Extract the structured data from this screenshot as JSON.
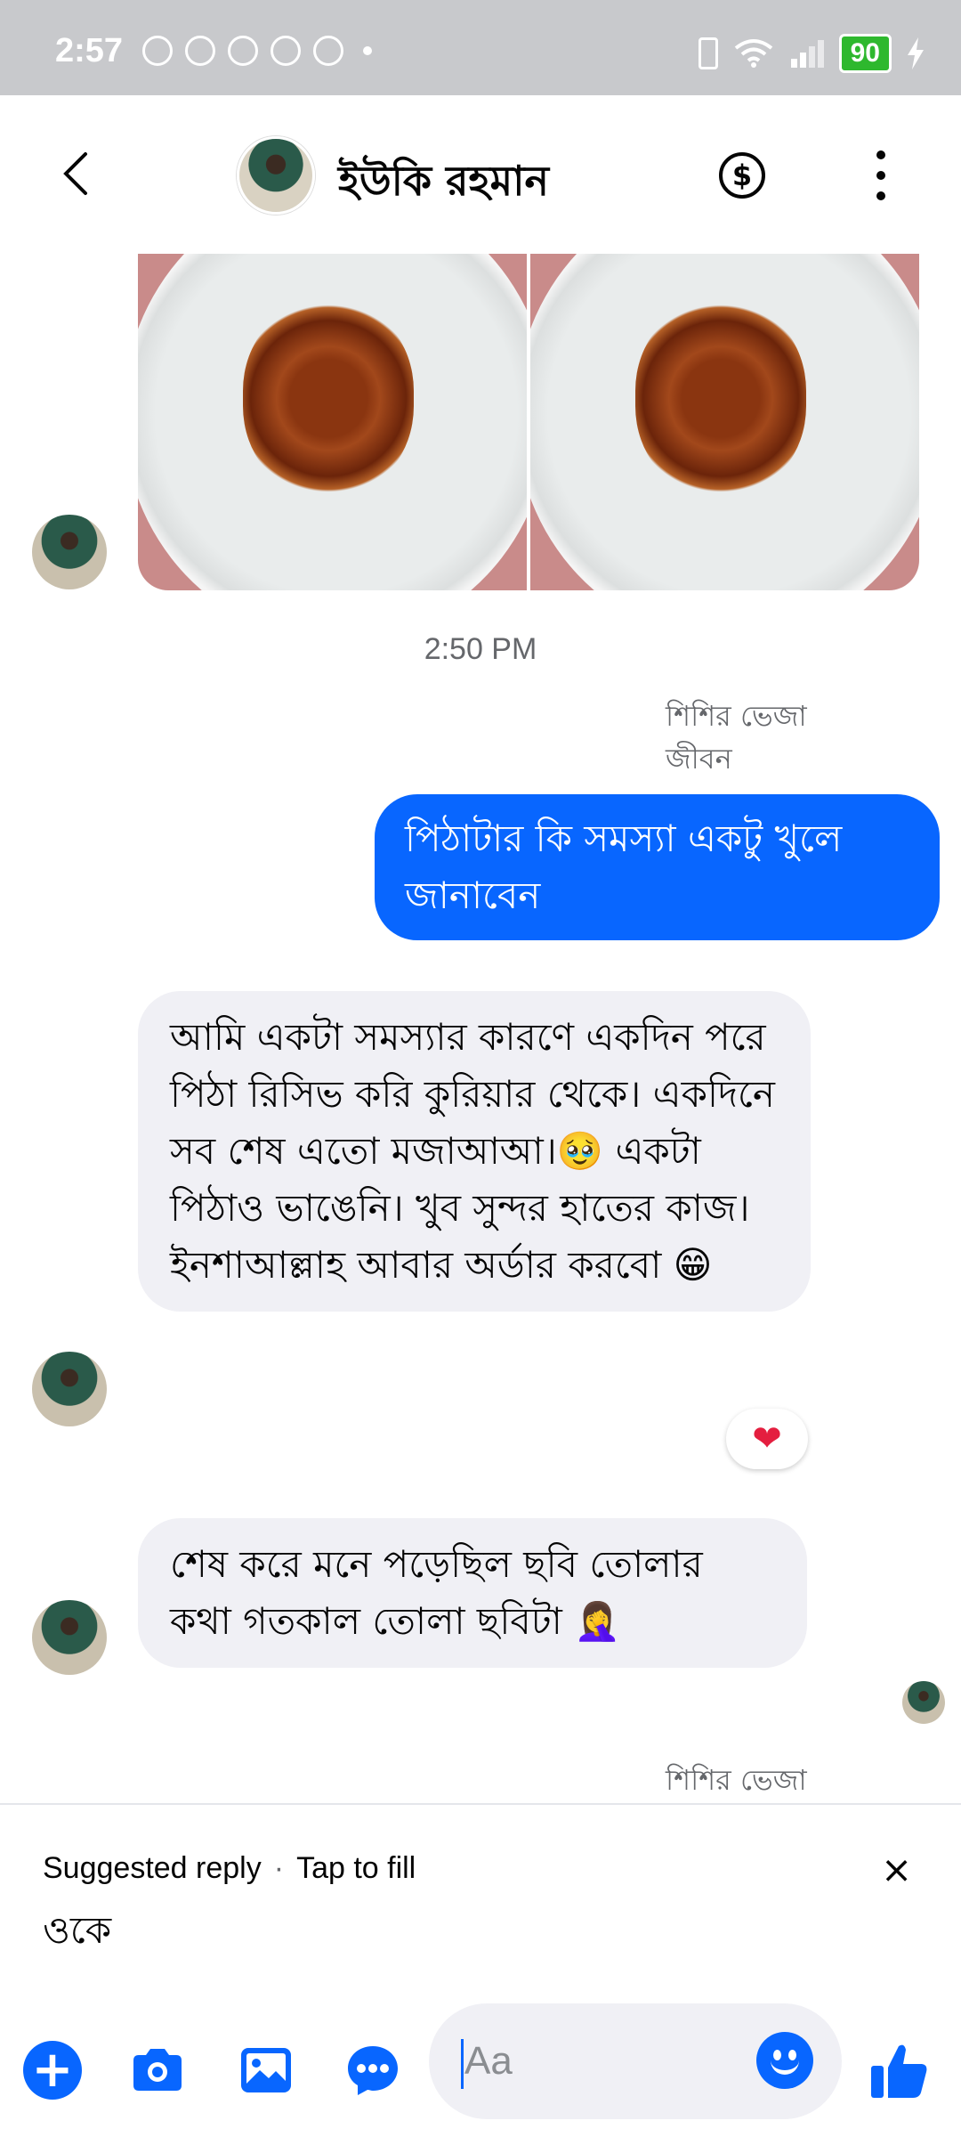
{
  "status_bar": {
    "time": "2:57",
    "battery": "90",
    "notification_icons": [
      "whatsapp-icon",
      "messenger-icon",
      "messenger-alt-icon",
      "facebook-icon",
      "facebook-icon",
      "dot-icon"
    ]
  },
  "header": {
    "contact_name": "ইউকি রহমান",
    "currency_symbol": "$"
  },
  "conversation": {
    "timestamp": "2:50 PM",
    "reply_label_1": "শিশির ভেজা জীবন",
    "outgoing_message": "পিঠাটার কি সমস্যা একটু খুলে জানাবেন",
    "incoming_message_1": "আমি একটা সমস্যার কারণে একদিন পরে পিঠা রিসিভ করি কুরিয়ার থেকে। একদিনে সব শেষ এতো মজাআআ।🥹 একটা পিঠাও ভাঙেনি। খুব সুন্দর হাতের কাজ। ইনশাআল্লাহ আবার অর্ডার করবো 😁",
    "reaction": "❤",
    "incoming_message_2": "শেষ করে মনে পড়েছিল ছবি তোলার কথা গতকাল তোলা ছবিটা 🤦‍♀️",
    "reply_label_2": "শিশির ভেজা"
  },
  "suggested_reply": {
    "label": "Suggested reply",
    "separator": "·",
    "action": "Tap to fill",
    "text": "ওকে",
    "close": "×"
  },
  "composer": {
    "placeholder": "Aa",
    "plus": "+"
  },
  "colors": {
    "accent": "#0866ff",
    "incoming_bubble": "#f0f0f5",
    "status_bar": "#c8c9cc",
    "battery": "#2eb82e"
  }
}
